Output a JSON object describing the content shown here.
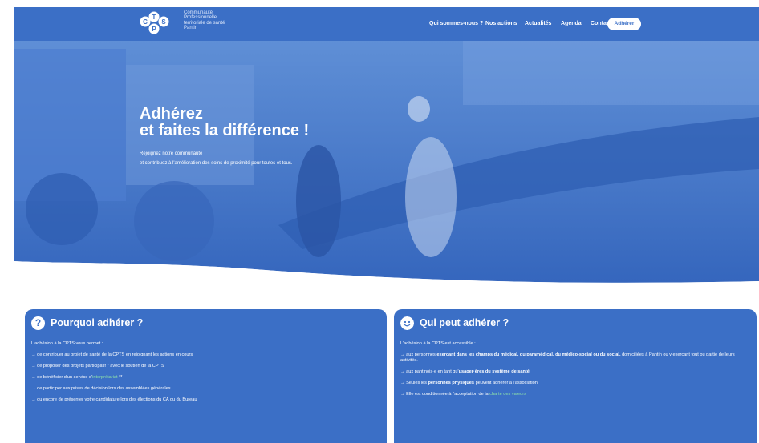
{
  "header": {
    "logo_text": [
      "Communauté",
      "Professionnelle",
      "territoriale de santé",
      "Pantin"
    ],
    "logo_letters": [
      "C",
      "T",
      "P",
      "S"
    ],
    "nav": [
      {
        "label": "Qui sommes-nous ?"
      },
      {
        "label": "Nos actions"
      },
      {
        "label": "Actualités"
      },
      {
        "label": "Agenda"
      },
      {
        "label": "Contact"
      }
    ],
    "cta_label": "Adhérer"
  },
  "hero": {
    "title_line1": "Adhérez",
    "title_line2": "et faites la différence !",
    "subtitle_line1": "Rejoignez notre communauté",
    "subtitle_line2": "et contribuez à l'amélioration des soins de proximité pour toutes et tous."
  },
  "card_left": {
    "icon": "question-icon",
    "title": "Pourquoi adhérer ?",
    "intro": "L'adhésion à la CPTS vous permet :",
    "items": [
      "→ de contribuer au projet de santé de la CPTS en rejoignant les actions en cours",
      "→ de proposer des projets participatif * avec le soutien de la CPTS",
      "→ de bénéficier d'un service d'",
      "→ de participer aux prises de décision lors des assemblées générales",
      "→ ou encore de présenter votre candidature lors des élections du CA ou du Bureau"
    ],
    "interpret_link": "interprétariat",
    "interpret_suffix": " **"
  },
  "card_right": {
    "icon": "smile-icon",
    "title": "Qui peut adhérer ?",
    "intro": "L'adhésion à la CPTS est accessible :",
    "item1_pre": "→ aux personnes ",
    "item1_bold": "exerçant dans les champs du médical, du paramédical, du médico-social ou du social,",
    "item1_post": " domiciliées à Pantin ou y exerçant tout ou partie de leurs activités.",
    "item2_pre": "→ aux pantinois·e en tant qu'",
    "item2_bold": "usager·ères du système de santé",
    "item3_pre": "→ Seules les ",
    "item3_bold": "personnes physiques",
    "item3_post": " peuvent adhérer à l'association",
    "item4_pre": "→ Elle est conditionnée à l'acceptation de la ",
    "item4_link": "charte des valeurs"
  },
  "colors": {
    "primary": "#3b6fc6",
    "highlight": "#8fe3a8"
  }
}
